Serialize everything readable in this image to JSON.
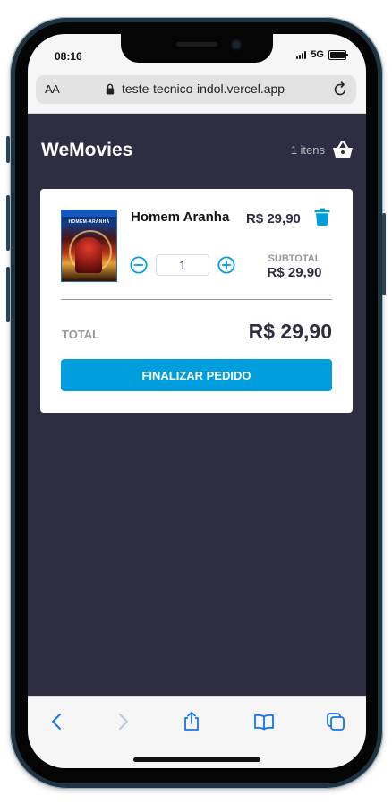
{
  "status_bar": {
    "time": "08:16",
    "network": "5G"
  },
  "browser": {
    "text_size_label": "AA",
    "url": "teste-tecnico-indol.vercel.app"
  },
  "header": {
    "brand": "WeMovies",
    "cart_count": "1 itens"
  },
  "cart": {
    "item": {
      "title": "Homem Aranha",
      "price": "R$ 29,90",
      "quantity": "1",
      "subtotal_label": "SUBTOTAL",
      "subtotal": "R$ 29,90",
      "poster_title": "HOMEM-ARANHA"
    },
    "total_label": "TOTAL",
    "total": "R$ 29,90",
    "checkout_label": "FINALIZAR PEDIDO"
  },
  "colors": {
    "background": "#2f2d41",
    "accent": "#009edd",
    "text_dark": "#2f2e41",
    "text_muted": "#999999"
  },
  "icons": [
    "lock-icon",
    "reload-icon",
    "basket-icon",
    "trash-icon",
    "minus-circle-icon",
    "plus-circle-icon",
    "back-icon",
    "forward-icon",
    "share-icon",
    "bookmarks-icon",
    "tabs-icon"
  ]
}
